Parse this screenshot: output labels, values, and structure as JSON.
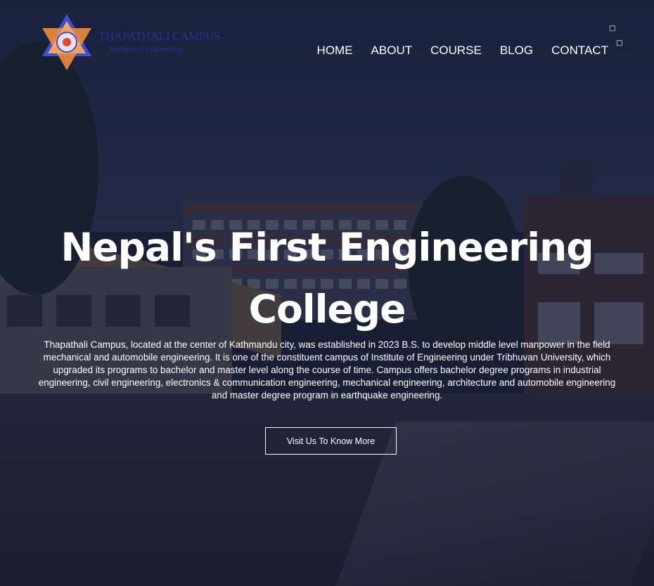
{
  "brand": {
    "name": "THAPATHALI CAMPUS",
    "subtitle": "Institute of Engineering",
    "colors": {
      "logo_orange": "#f08a3c",
      "logo_blue": "#3d4fd6",
      "logo_text": "#2a2f9c"
    }
  },
  "nav": {
    "items": [
      {
        "label": "HOME"
      },
      {
        "label": "ABOUT"
      },
      {
        "label": "COURSE"
      },
      {
        "label": "BLOG"
      },
      {
        "label": "CONTACT"
      }
    ],
    "utility_icons": [
      "search-icon",
      "menu-icon"
    ]
  },
  "hero": {
    "title": "Nepal's First Engineering College",
    "description": "Thapathali Campus, located at the center of Kathmandu city, was established in 2023 B.S. to develop middle level manpower in the field mechanical and automobile engineering. It is one of the constituent campus of Institute of Engineering under Tribhuvan University, which upgraded its programs to bachelor and master level along the course of time. Campus offers bachelor degree programs in industrial engineering, civil engineering, electronics & communication engineering, mechanical engineering, architecture and automobile engineering and master degree program in earthquake engineering.",
    "cta_label": "Visit Us To Know More"
  }
}
